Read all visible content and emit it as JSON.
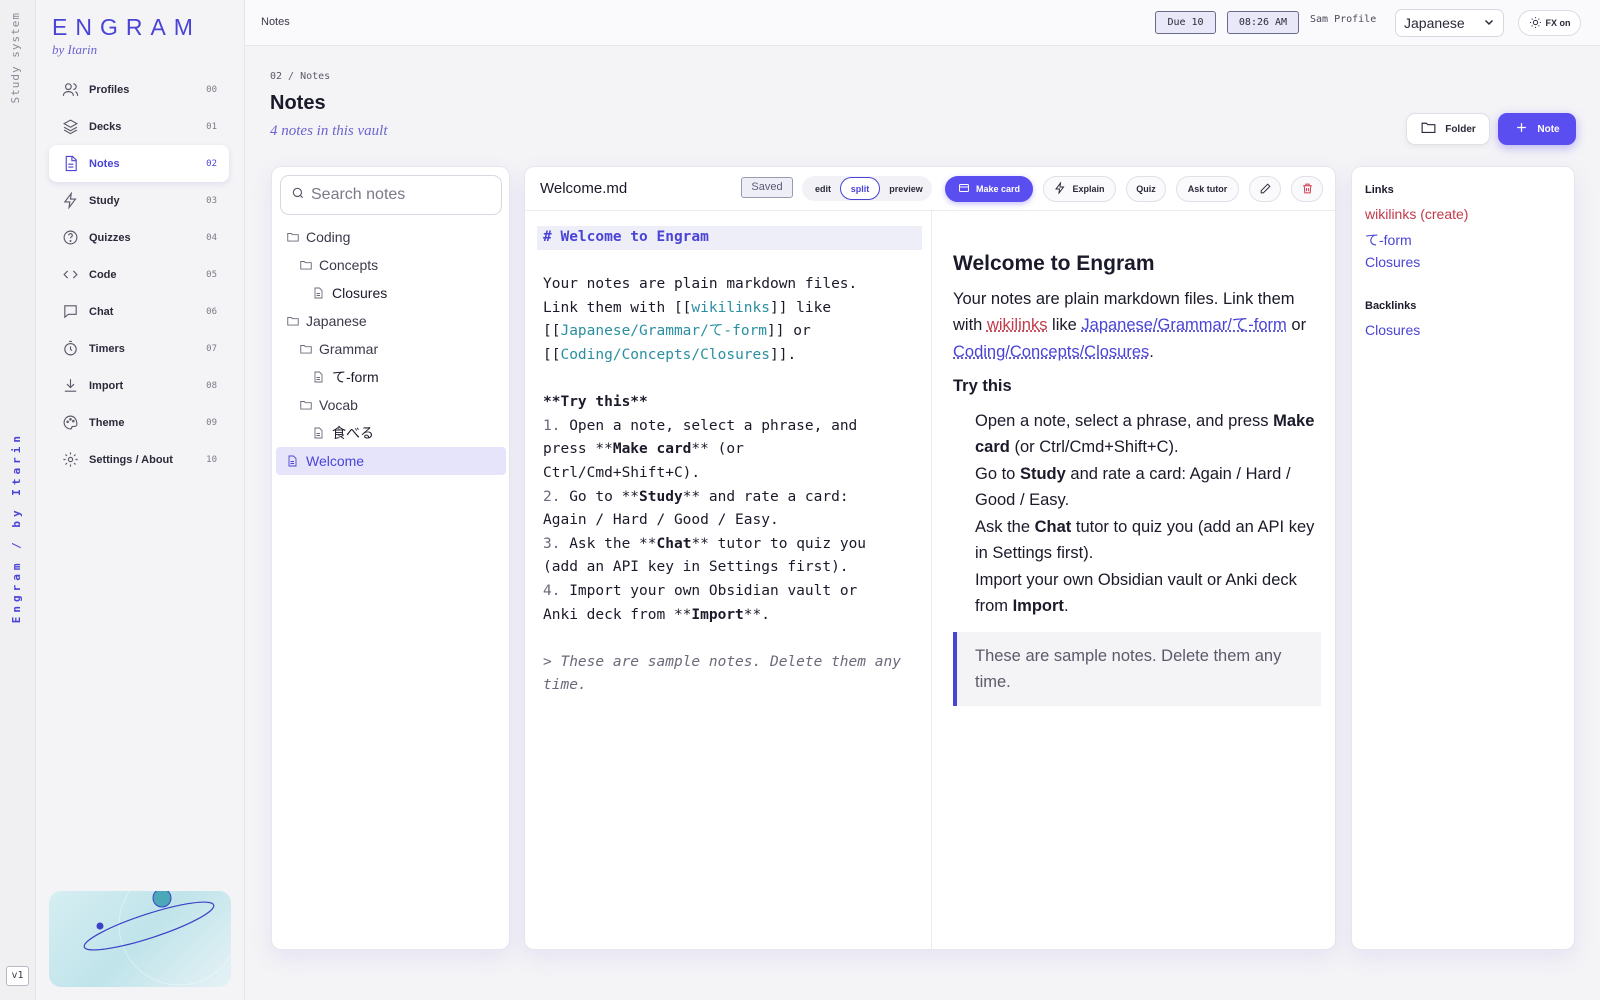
{
  "rail": {
    "top_label": "Study system",
    "brand": "Engram / by Itarin",
    "version": "v1"
  },
  "logo": {
    "name": "ENGRAM",
    "by": "by Itarin"
  },
  "nav": [
    {
      "label": "Profiles",
      "num": "00",
      "icon": "users-icon"
    },
    {
      "label": "Decks",
      "num": "01",
      "icon": "layers-icon"
    },
    {
      "label": "Notes",
      "num": "02",
      "icon": "document-icon",
      "active": true
    },
    {
      "label": "Study",
      "num": "03",
      "icon": "bolt-icon"
    },
    {
      "label": "Quizzes",
      "num": "04",
      "icon": "help-circle-icon"
    },
    {
      "label": "Code",
      "num": "05",
      "icon": "code-icon"
    },
    {
      "label": "Chat",
      "num": "06",
      "icon": "chat-icon"
    },
    {
      "label": "Timers",
      "num": "07",
      "icon": "timer-icon"
    },
    {
      "label": "Import",
      "num": "08",
      "icon": "download-icon"
    },
    {
      "label": "Theme",
      "num": "09",
      "icon": "palette-icon"
    },
    {
      "label": "Settings / About",
      "num": "10",
      "icon": "gear-icon"
    }
  ],
  "topbar": {
    "crumb": "Notes",
    "due": "Due 10",
    "time": "08:26 AM",
    "profile": "Sam Profile",
    "language": "Japanese",
    "fx": "FX on"
  },
  "page": {
    "crumb": "02 / Notes",
    "title": "Notes",
    "subtitle": "4 notes in this vault",
    "folder_btn": "Folder",
    "note_btn": "Note"
  },
  "tree": {
    "search_placeholder": "Search notes",
    "items": [
      {
        "label": "Coding",
        "type": "folder",
        "level": 0
      },
      {
        "label": "Concepts",
        "type": "folder",
        "level": 1
      },
      {
        "label": "Closures",
        "type": "file",
        "level": 2
      },
      {
        "label": "Japanese",
        "type": "folder",
        "level": 0
      },
      {
        "label": "Grammar",
        "type": "folder",
        "level": 1
      },
      {
        "label": "て-form",
        "type": "file",
        "level": 2
      },
      {
        "label": "Vocab",
        "type": "folder",
        "level": 1
      },
      {
        "label": "食べる",
        "type": "file",
        "level": 2
      },
      {
        "label": "Welcome",
        "type": "file",
        "level": 0,
        "active": true
      }
    ]
  },
  "editor": {
    "filename": "Welcome.md",
    "status": "Saved",
    "modes": [
      "edit",
      "split",
      "preview"
    ],
    "active_mode": "split",
    "make_card": "Make card",
    "explain": "Explain",
    "quiz": "Quiz",
    "ask_tutor": "Ask tutor",
    "source": {
      "heading": "# Welcome to Engram",
      "p1a": "Your notes are plain markdown files.",
      "p1b": "Link them with [[",
      "wikilinks": "wikilinks",
      "p1c": "]] like",
      "p1d": "[[",
      "link_jp": "Japanese/Grammar/て-form",
      "p1e": "]] or",
      "link_code": "Coding/Concepts/Closures",
      "p1f": "]].",
      "try": "**Try this**",
      "try_b": "Try this",
      "s1a": "Open a note, select a phrase, and",
      "s1b": "press **",
      "s1bold": "Make card",
      "s1c": "** (or",
      "s1d": "Ctrl/Cmd+Shift+C).",
      "s2a": "Go to **",
      "s2bold": "Study",
      "s2b": "** and rate a card:",
      "s2c": "Again / Hard / Good / Easy.",
      "s3a": "Ask the **",
      "s3bold": "Chat",
      "s3b": "** tutor to quiz you",
      "s3c": "(add an API key in Settings first).",
      "s4a": "Import your own Obsidian vault or",
      "s4b": "Anki deck from **",
      "s4bold": "Import",
      "s4c": "**.",
      "quote": "> These are sample notes. Delete them any time."
    },
    "preview": {
      "title": "Welcome to Engram",
      "p1a": "Your notes are plain markdown files. Link them with",
      "wikilinks": "wikilinks",
      "like": "like",
      "link_jp": "Japanese/Grammar/て-form",
      "or": "or",
      "link_code": "Coding/Concepts/Closures",
      "try": "Try this",
      "s1a": "Open a note, select a phrase, and press",
      "s1bold": "Make card",
      "s1b": "(or Ctrl/Cmd+Shift+C).",
      "s2a": "Go to",
      "s2bold": "Study",
      "s2b": "and rate a card: Again / Hard / Good / Easy.",
      "s3a": "Ask the",
      "s3bold": "Chat",
      "s3b": "tutor to quiz you (add an API key in Settings first).",
      "s4a": "Import your own Obsidian vault or Anki deck from",
      "s4bold": "Import",
      "quote": "These are sample notes. Delete them any time."
    }
  },
  "links_panel": {
    "links_title": "Links",
    "links": [
      {
        "label": "wikilinks (create)",
        "color": "#c23a4a"
      },
      {
        "label": "て-form",
        "color": "#4a44d6"
      },
      {
        "label": "Closures",
        "color": "#4a44d6"
      }
    ],
    "backlinks_title": "Backlinks",
    "backlinks": [
      {
        "label": "Closures"
      }
    ]
  },
  "colors": {
    "accent": "#5b4ef0",
    "accent_text": "#4a44d6",
    "missing_link": "#c23a4a",
    "code_link": "#2a8fa0"
  }
}
